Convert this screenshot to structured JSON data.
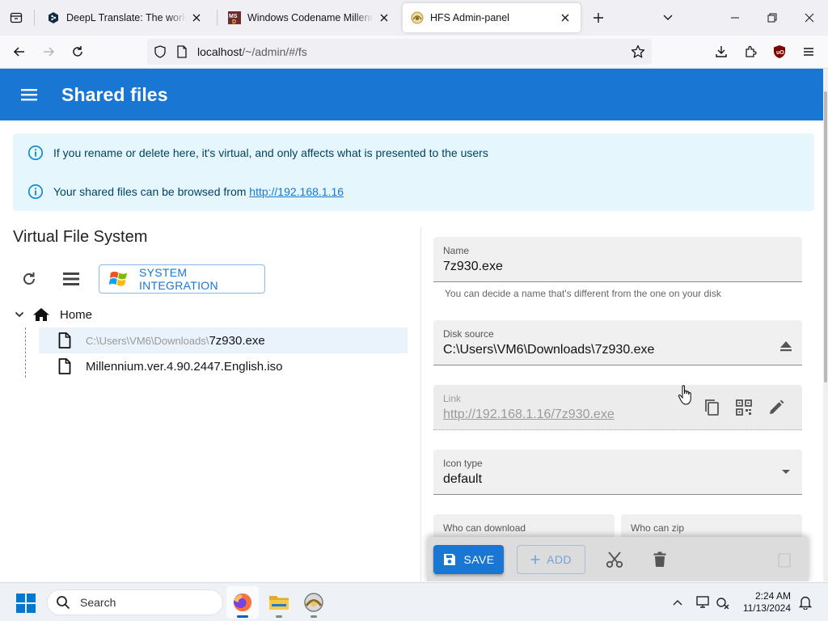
{
  "browser": {
    "tabs": [
      {
        "title": "DeepL Translate: The world's most accurate translator",
        "favicon": "deepl-icon"
      },
      {
        "title": "Windows Codename Millennium",
        "favicon": "msdn-icon"
      },
      {
        "title": "HFS Admin-panel",
        "favicon": "hfs-icon",
        "active": true
      }
    ],
    "url_host": "localhost",
    "url_path": "/~/admin/#/fs"
  },
  "app": {
    "title": "Shared files",
    "color_primary": "#1976d2"
  },
  "info": {
    "line1": "If you rename or delete here, it's virtual, and only affects what is presented to the users",
    "line2_prefix": "Your shared files can be browsed from ",
    "line2_link": "http://192.168.1.16"
  },
  "vfs": {
    "title": "Virtual File System",
    "system_integration_label": "SYSTEM INTEGRATION",
    "root_label": "Home",
    "items": [
      {
        "path_prefix": "C:\\Users\\VM6\\Downloads\\",
        "name": "7z930.exe",
        "selected": true
      },
      {
        "path_prefix": "",
        "name": "Millennium.ver.4.90.2447.English.iso",
        "selected": false
      }
    ]
  },
  "details": {
    "name_label": "Name",
    "name_value": "7z930.exe",
    "name_helper": "You can decide a name that's different from the one on your disk",
    "source_label": "Disk source",
    "source_value": "C:\\Users\\VM6\\Downloads\\7z930.exe",
    "link_label": "Link",
    "link_value": "http://192.168.1.16/7z930.exe",
    "icon_label": "Icon type",
    "icon_value": "default",
    "download_label": "Who can download",
    "zip_label": "Who can zip"
  },
  "actions": {
    "save_label": "SAVE",
    "add_label": "ADD"
  },
  "taskbar": {
    "search_placeholder": "Search",
    "time": "2:24 AM",
    "date": "11/13/2024"
  }
}
